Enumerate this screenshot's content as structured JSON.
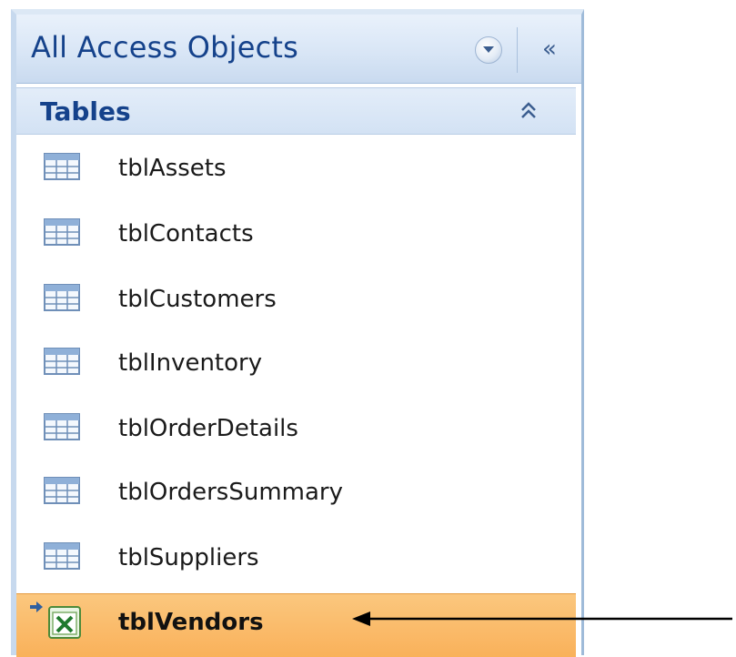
{
  "navigation_pane": {
    "title": "All Access Objects",
    "collapse_glyph": "«",
    "group": {
      "label": "Tables"
    },
    "items": [
      {
        "label": "tblAssets",
        "icon": "table-icon"
      },
      {
        "label": "tblContacts",
        "icon": "table-icon"
      },
      {
        "label": "tblCustomers",
        "icon": "table-icon"
      },
      {
        "label": "tblInventory",
        "icon": "table-icon"
      },
      {
        "label": "tblOrderDetails",
        "icon": "table-icon"
      },
      {
        "label": "tblOrdersSummary",
        "icon": "table-icon"
      },
      {
        "label": "tblSuppliers",
        "icon": "table-icon"
      },
      {
        "label": "tblVendors",
        "icon": "excel-linked-table-icon",
        "selected": true
      }
    ]
  },
  "colors": {
    "title_text": "#15428b",
    "selected_row": "#f9b15a",
    "pane_border": "#c7d9ee"
  }
}
